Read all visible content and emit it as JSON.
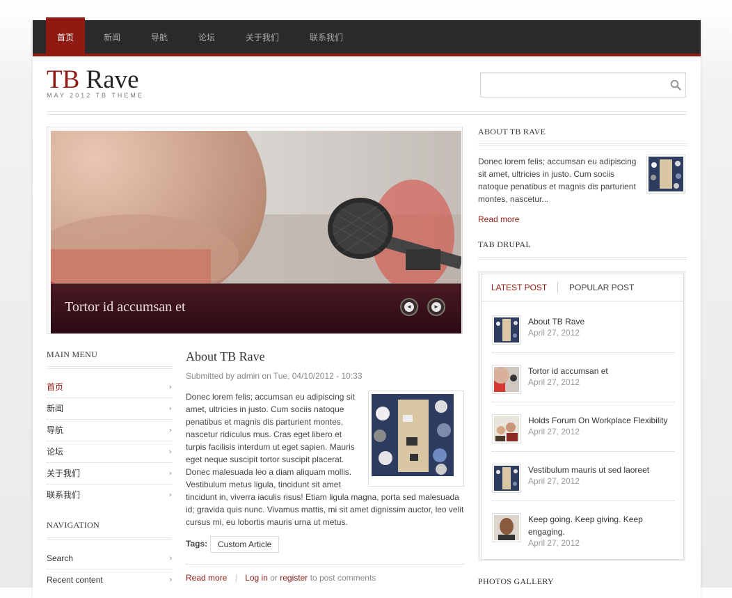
{
  "nav": {
    "items": [
      "首页",
      "新闻",
      "导航",
      "论坛",
      "关于我们",
      "联系我们"
    ]
  },
  "header": {
    "logo_tb": "TB",
    "logo_rave": "Rave",
    "tagline": "MAY 2012 TB THEME",
    "search_placeholder": ""
  },
  "slider": {
    "caption": "Tortor id accumsan et",
    "prev": "◄",
    "next": "►"
  },
  "main_menu": {
    "title": "MAIN MENU",
    "items": [
      "首页",
      "新闻",
      "导航",
      "论坛",
      "关于我们",
      "联系我们"
    ]
  },
  "navigation": {
    "title": "NAVIGATION",
    "items": [
      "Search",
      "Recent content"
    ]
  },
  "article": {
    "title": "About TB Rave",
    "submitted": "Submitted by admin on Tue, 04/10/2012 - 10:33",
    "body": "Donec lorem felis; accumsan eu adipiscing sit amet, ultricies in justo. Cum sociis natoque penatibus et magnis dis parturient montes, nascetur ridiculus mus. Cras eget libero et turpis facilisis interdum ut eget sapien. Mauris eget neque suscipit tortor suscipit placerat. Donec malesuada leo a diam aliquam mollis. Vestibulum metus ligula, tincidunt sit amet tincidunt in, viverra iaculis risus! Etiam ligula magna, porta sed malesuada id; gravida quis nunc. Vivamus mattis, mi sit amet dignissim auctor, leo velit cursus mi, eu lobortis mauris urna ut metus.",
    "tags_label": "Tags:",
    "tag": "Custom Article",
    "read_more": "Read more",
    "log_in": "Log in",
    "or": "or",
    "register": "register",
    "to_post": "to post comments"
  },
  "sidebar": {
    "about_title": "ABOUT TB RAVE",
    "about_text": "Donec lorem felis; accumsan eu adipiscing sit amet, ultricies in justo. Cum sociis natoque penatibus et magnis dis parturient montes, nascetur...",
    "read_more": "Read more",
    "tab_title": "TAB DRUPAL",
    "tabs": [
      "LATEST POST",
      "POPULAR POST"
    ],
    "posts": [
      {
        "title": "About TB Rave",
        "date": "April 27, 2012"
      },
      {
        "title": "Tortor id accumsan et",
        "date": "April 27, 2012"
      },
      {
        "title": "Holds Forum On Workplace Flexibility",
        "date": "April 27, 2012"
      },
      {
        "title": "Vestibulum mauris ut sed laoreet",
        "date": "April 27, 2012"
      },
      {
        "title": "Keep going. Keep giving. Keep engaging.",
        "date": "April 27, 2012"
      }
    ],
    "gallery_title": "PHOTOS GALLERY"
  },
  "colors": {
    "accent": "#8f1a12",
    "nav_bg": "#2a2a2a"
  }
}
